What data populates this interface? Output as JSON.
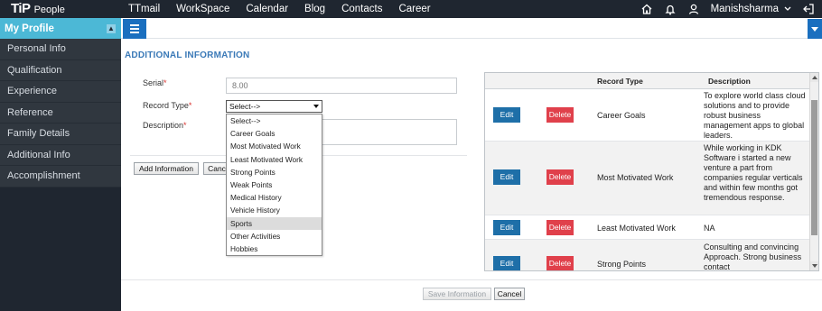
{
  "brand": {
    "logo": "TiP",
    "product": "People"
  },
  "nav": [
    "TTmail",
    "WorkSpace",
    "Calendar",
    "Blog",
    "Contacts",
    "Career"
  ],
  "user": {
    "name": "Manishsharma"
  },
  "sidebar": {
    "header": "My Profile",
    "items": [
      "Personal Info",
      "Qualification",
      "Experience",
      "Reference",
      "Family Details",
      "Additional Info",
      "Accomplishment"
    ]
  },
  "form": {
    "title": "ADDITIONAL INFORMATION",
    "serial_label": "Serial",
    "serial_value": "8.00",
    "record_type_label": "Record Type",
    "record_type_selected": "Select-->",
    "description_label": "Description",
    "required_mark": "*",
    "options": [
      "Select-->",
      "Career Goals",
      "Most Motivated Work",
      "Least Motivated Work",
      "Strong Points",
      "Weak Points",
      "Medical History",
      "Vehicle History",
      "Sports",
      "Other Activities",
      "Hobbies"
    ],
    "highlighted_option": "Sports",
    "add_button": "Add Information",
    "cancel_button_partial": "Canc",
    "save_button": "Save Information",
    "cancel_button": "Cancel"
  },
  "table": {
    "headers": [
      "Record Type",
      "Description"
    ],
    "edit_label": "Edit",
    "delete_label": "Delete",
    "rows": [
      {
        "type": "Career Goals",
        "desc": "To explore world class cloud solutions and to provide robust business management apps to global leaders."
      },
      {
        "type": "Most Motivated Work",
        "desc": "While working in KDK Software i started a new venture a part from companies regular verticals and within few months got tremendous response."
      },
      {
        "type": "Least Motivated Work",
        "desc": "NA"
      },
      {
        "type": "Strong Points",
        "desc": "Consulting and convincing Approach. Strong business contact"
      }
    ]
  },
  "colors": {
    "topbar": "#1f2630",
    "accent": "#4cb8d6",
    "primary": "#1a6fbf",
    "danger": "#e0404b"
  }
}
